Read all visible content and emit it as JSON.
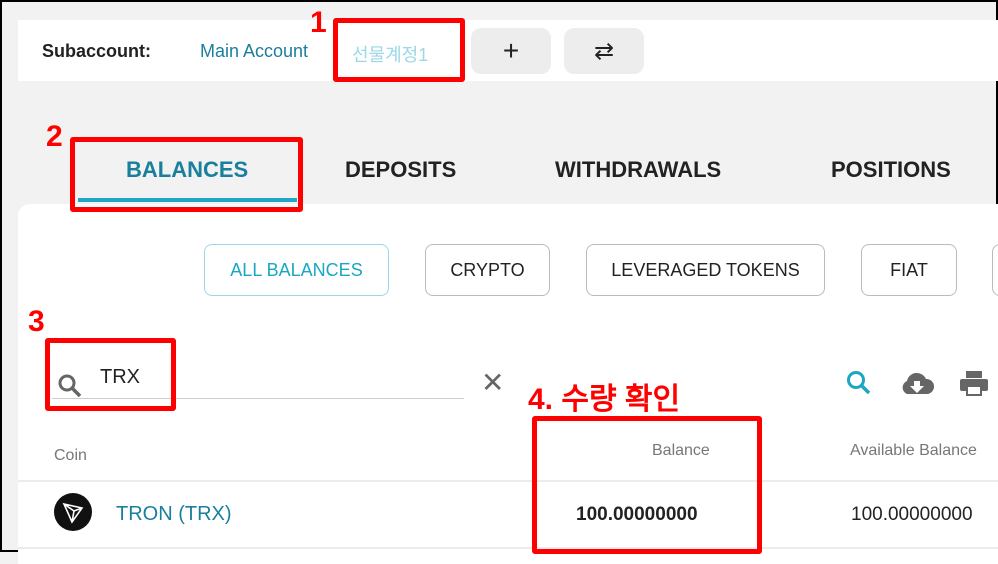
{
  "subaccount": {
    "label": "Subaccount:",
    "accounts": [
      "Main Account",
      "선물계정1"
    ],
    "add_icon": "plus-icon",
    "switch_icon": "swap-arrows-icon"
  },
  "tabs": [
    "BALANCES",
    "DEPOSITS",
    "WITHDRAWALS",
    "POSITIONS"
  ],
  "filters": [
    "ALL BALANCES",
    "CRYPTO",
    "LEVERAGED TOKENS",
    "FIAT"
  ],
  "search": {
    "value": "TRX"
  },
  "toolbar_icons": [
    "search-icon",
    "cloud-download-icon",
    "printer-icon"
  ],
  "table": {
    "headers": [
      "Coin",
      "Balance",
      "Available Balance"
    ],
    "rows": [
      {
        "coin": "TRON (TRX)",
        "balance": "100.00000000",
        "available": "100.00000000"
      }
    ]
  },
  "annotations": {
    "n1": "1",
    "n2": "2",
    "n3": "3",
    "n4": "4. 수량 확인"
  },
  "colors": {
    "accent": "#1a7f9c",
    "annotation": "#ff0000"
  }
}
